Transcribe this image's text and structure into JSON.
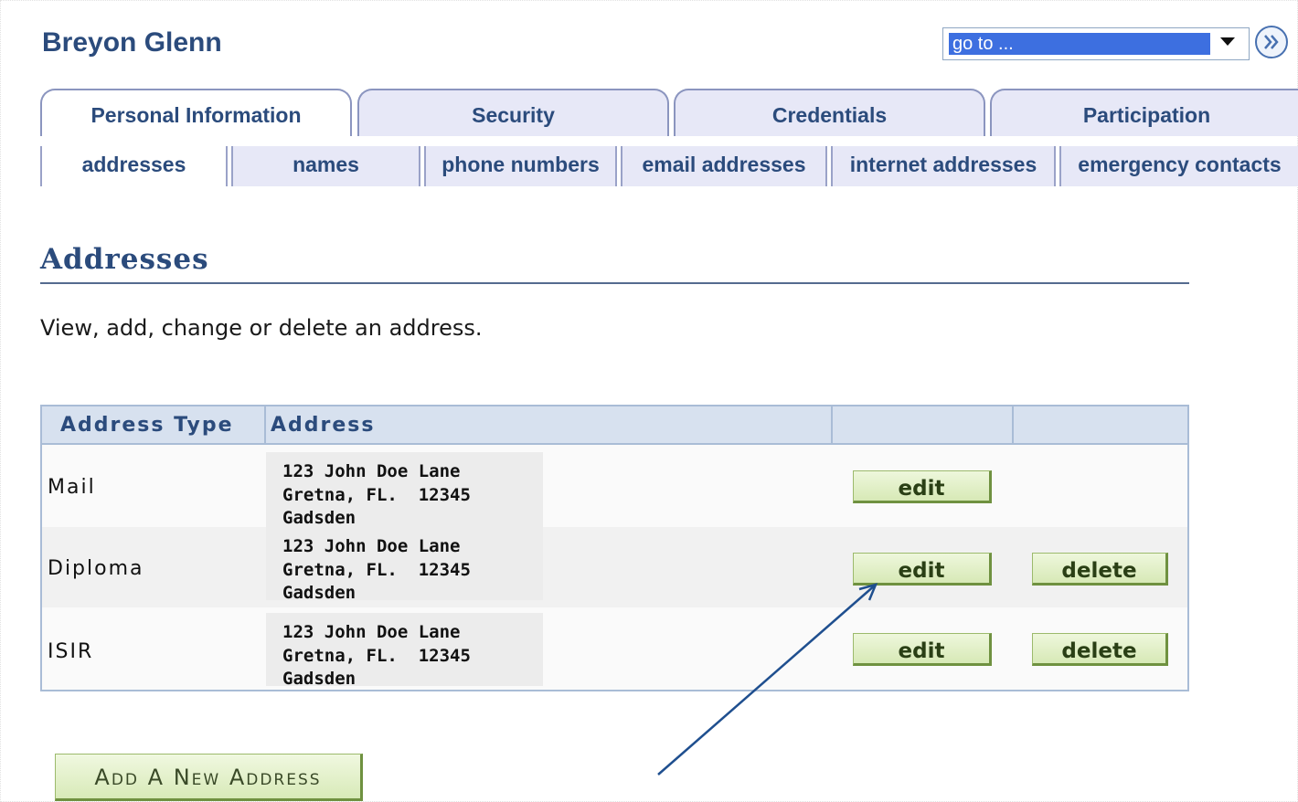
{
  "header": {
    "person_name": "Breyon Glenn"
  },
  "goto": {
    "value": "go to ..."
  },
  "main_tabs": [
    {
      "label": "Personal Information",
      "active": true
    },
    {
      "label": "Security",
      "active": false
    },
    {
      "label": "Credentials",
      "active": false
    },
    {
      "label": "Participation",
      "active": false
    }
  ],
  "sub_tabs": [
    {
      "label": "addresses",
      "active": true
    },
    {
      "label": "names",
      "active": false
    },
    {
      "label": "phone numbers",
      "active": false
    },
    {
      "label": "email addresses",
      "active": false
    },
    {
      "label": "internet addresses",
      "active": false
    },
    {
      "label": "emergency contacts",
      "active": false
    }
  ],
  "page": {
    "title": "Addresses",
    "intro": "View, add, change or delete an address."
  },
  "table": {
    "headers": [
      "Address Type",
      "Address",
      "",
      ""
    ],
    "rows": [
      {
        "type": "Mail",
        "address": [
          "123 John Doe Lane",
          "Gretna, FL.  12345",
          "Gadsden"
        ],
        "edit": "edit",
        "delete": ""
      },
      {
        "type": "Diploma",
        "address": [
          "123 John Doe Lane",
          "Gretna, FL.  12345",
          "Gadsden"
        ],
        "edit": "edit",
        "delete": "delete"
      },
      {
        "type": "ISIR",
        "address": [
          "123 John Doe Lane",
          "Gretna, FL.  12345",
          "Gadsden"
        ],
        "edit": "edit",
        "delete": "delete"
      }
    ]
  },
  "add_button": "Add A New Address",
  "colors": {
    "brand_text": "#2b4b7c",
    "tab_fill": "#e7e8f7",
    "button_green": "#d7e9b6",
    "annotation": "#1f4f8f"
  },
  "icons": {
    "goto_button": "double-chevron-right-icon",
    "dropdown": "caret-down-icon"
  }
}
